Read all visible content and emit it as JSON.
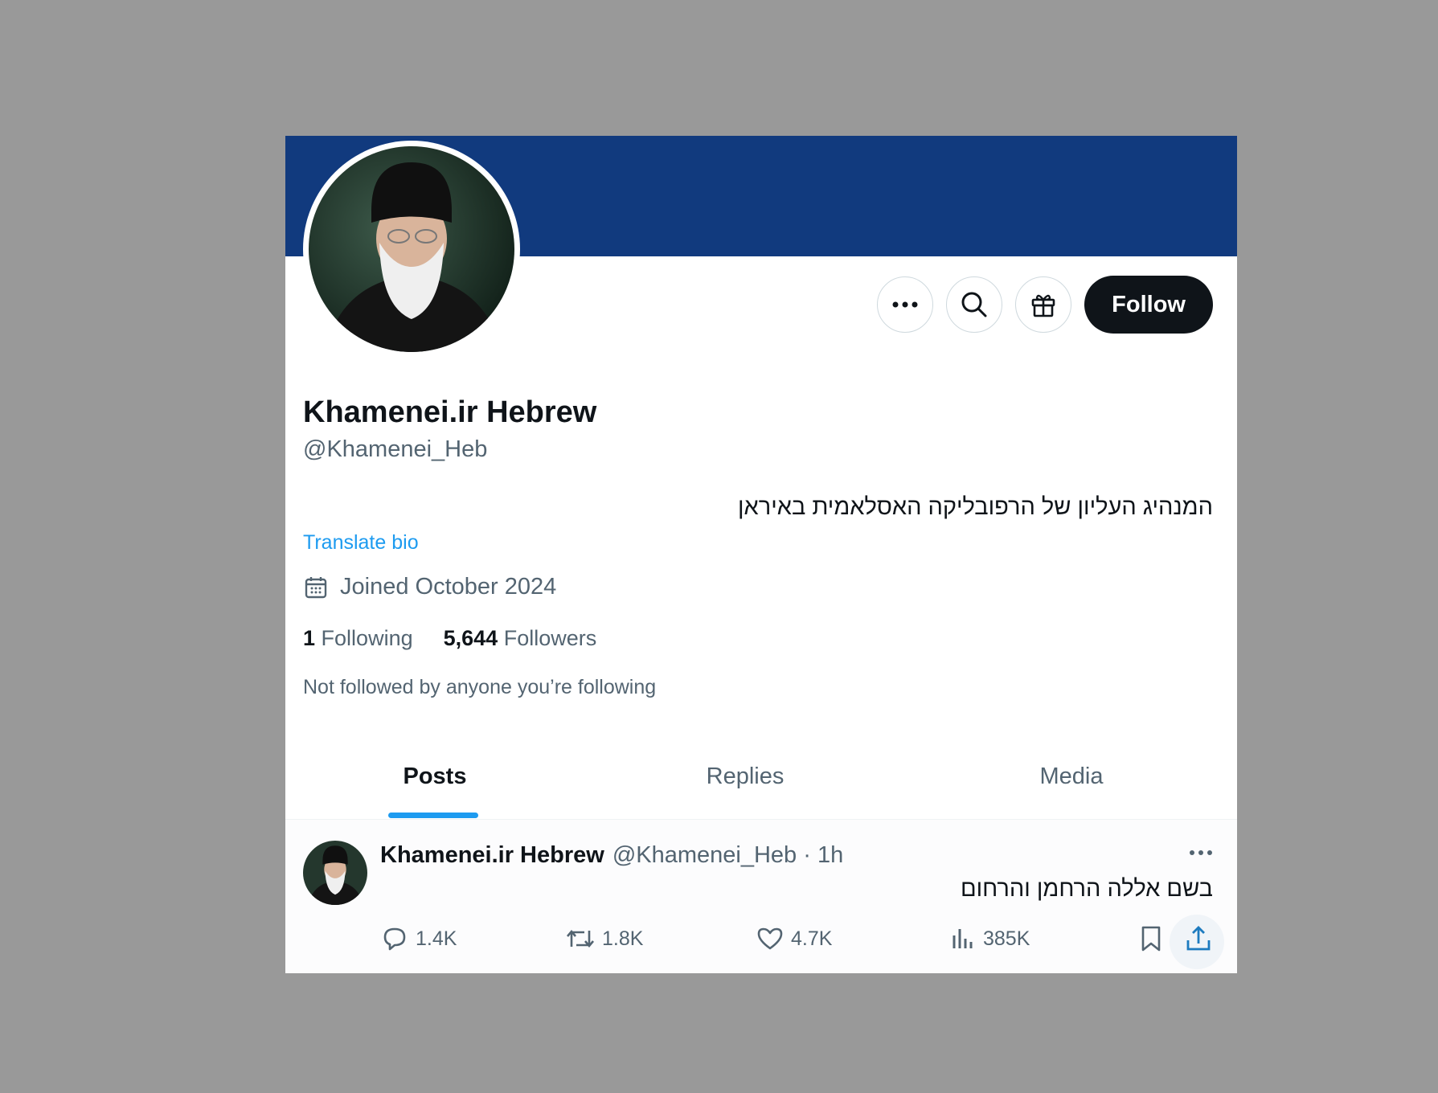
{
  "profile": {
    "display_name": "Khamenei.ir Hebrew",
    "handle": "@Khamenei_Heb",
    "bio": "המנהיג העליון של הרפובליקה האסלאמית באיראן",
    "translate_label": "Translate bio",
    "joined": "Joined October 2024",
    "following_count": "1",
    "following_label": "Following",
    "followers_count": "5,644",
    "followers_label": "Followers",
    "not_followed_text": "Not followed by anyone you’re following",
    "banner_color": "#113a7e"
  },
  "actions": {
    "follow_label": "Follow",
    "icons": [
      "more-icon",
      "search-icon",
      "gift-icon"
    ]
  },
  "tabs": [
    {
      "label": "Posts",
      "active": true
    },
    {
      "label": "Replies",
      "active": false
    },
    {
      "label": "Media",
      "active": false
    }
  ],
  "post": {
    "author_name": "Khamenei.ir Hebrew",
    "author_meta": "@Khamenei_Heb · 1h",
    "text": "בשם אללה הרחמן והרחום",
    "replies": "1.4K",
    "reposts": "1.8K",
    "likes": "4.7K",
    "views": "385K"
  },
  "colors": {
    "accent": "#1d9bf0",
    "secondary_text": "#536471",
    "primary_text": "#0f1419"
  }
}
